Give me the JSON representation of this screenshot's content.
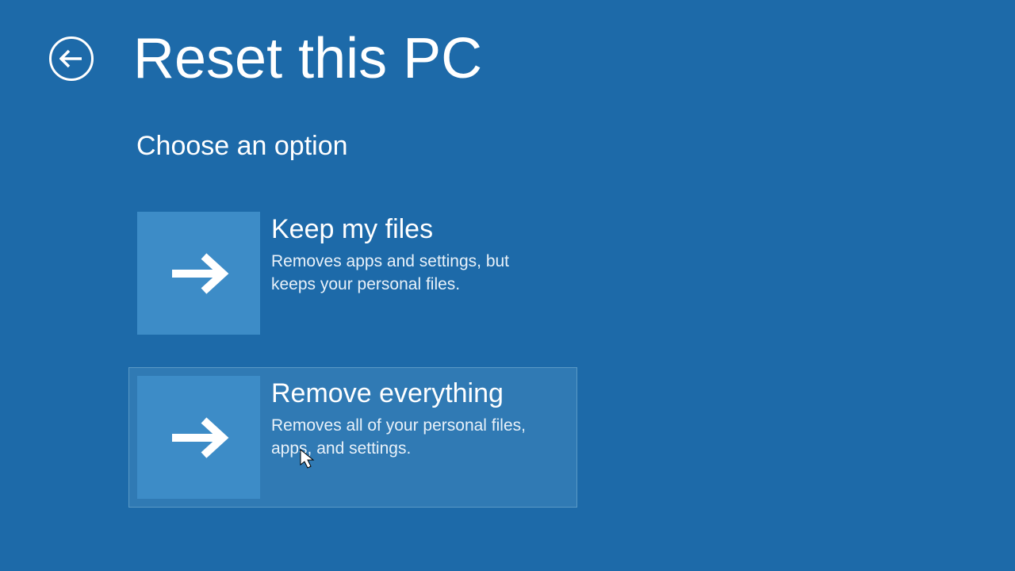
{
  "header": {
    "title": "Reset this PC"
  },
  "subtitle": "Choose an option",
  "options": [
    {
      "title": "Keep my files",
      "desc": "Removes apps and settings, but keeps your personal files."
    },
    {
      "title": "Remove everything",
      "desc": "Removes all of your personal files, apps, and settings."
    }
  ],
  "colors": {
    "background": "#1d6aa9",
    "tile": "#3d8cc7",
    "hover": "#307ab4"
  }
}
